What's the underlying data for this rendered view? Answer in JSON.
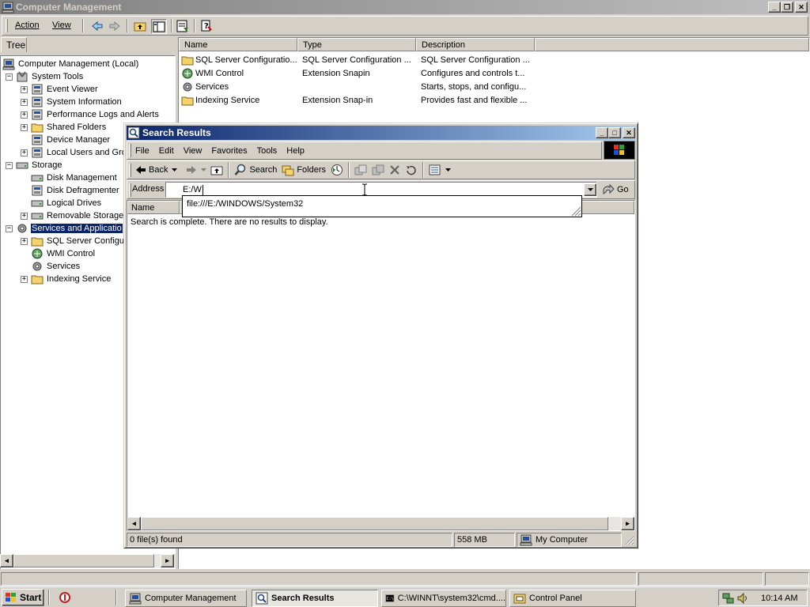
{
  "mmc": {
    "title": "Computer Management",
    "menu": [
      "Action",
      "View"
    ],
    "tree_tab": "Tree",
    "tree": [
      {
        "label": "Computer Management (Local)",
        "level": 0,
        "expander": ""
      },
      {
        "label": "System Tools",
        "level": 1,
        "expander": "−"
      },
      {
        "label": "Event Viewer",
        "level": 2,
        "expander": "+"
      },
      {
        "label": "System Information",
        "level": 2,
        "expander": "+"
      },
      {
        "label": "Performance Logs and Alerts",
        "level": 2,
        "expander": "+"
      },
      {
        "label": "Shared Folders",
        "level": 2,
        "expander": "+"
      },
      {
        "label": "Device Manager",
        "level": 2,
        "expander": ""
      },
      {
        "label": "Local Users and Gro",
        "level": 2,
        "expander": "+"
      },
      {
        "label": "Storage",
        "level": 1,
        "expander": "−"
      },
      {
        "label": "Disk Management",
        "level": 2,
        "expander": ""
      },
      {
        "label": "Disk Defragmenter",
        "level": 2,
        "expander": ""
      },
      {
        "label": "Logical Drives",
        "level": 2,
        "expander": ""
      },
      {
        "label": "Removable Storage",
        "level": 2,
        "expander": "+"
      },
      {
        "label": "Services and Applicatio",
        "level": 1,
        "expander": "−",
        "selected": true
      },
      {
        "label": "SQL Server Configu",
        "level": 2,
        "expander": "+"
      },
      {
        "label": "WMI Control",
        "level": 2,
        "expander": ""
      },
      {
        "label": "Services",
        "level": 2,
        "expander": ""
      },
      {
        "label": "Indexing Service",
        "level": 2,
        "expander": "+"
      }
    ],
    "columns": [
      "Name",
      "Type",
      "Description"
    ],
    "rows": [
      {
        "name": "SQL Server Configuratio...",
        "type": "SQL Server Configuration ...",
        "description": "SQL Server Configuration ...",
        "icon": "folder-icon"
      },
      {
        "name": "WMI Control",
        "type": "Extension Snapin",
        "description": "Configures and controls t...",
        "icon": "wmi-icon"
      },
      {
        "name": "Services",
        "type": "",
        "description": "Starts, stops, and configu...",
        "icon": "services-icon"
      },
      {
        "name": "Indexing Service",
        "type": "Extension Snap-in",
        "description": "Provides fast and flexible ...",
        "icon": "folder-icon"
      }
    ]
  },
  "search": {
    "title": "Search Results",
    "menu": [
      "File",
      "Edit",
      "View",
      "Favorites",
      "Tools",
      "Help"
    ],
    "back_label": "Back",
    "search_label": "Search",
    "folders_label": "Folders",
    "address_label": "Address",
    "address_value": "E:/W",
    "go_label": "Go",
    "autocomplete": "file:///E:/WINDOWS/System32",
    "col_name": "Name",
    "message": "Search is complete. There are no results to display.",
    "status_files": "0 file(s) found",
    "status_size": "558 MB",
    "status_zone": "My Computer"
  },
  "taskbar": {
    "start_label": "Start",
    "buttons": [
      {
        "label": "Computer Management",
        "active": false
      },
      {
        "label": "Search Results",
        "active": true
      },
      {
        "label": "C:\\WINNT\\system32\\cmd....",
        "active": false
      },
      {
        "label": "Control Panel",
        "active": false
      }
    ],
    "clock": "10:14 AM"
  },
  "colors": {
    "title_active_start": "#0a246a",
    "title_active_end": "#a6caf0",
    "title_inactive_start": "#808080",
    "title_inactive_end": "#c0c0c0",
    "selection": "#0a246a",
    "face": "#d4d0c8"
  }
}
